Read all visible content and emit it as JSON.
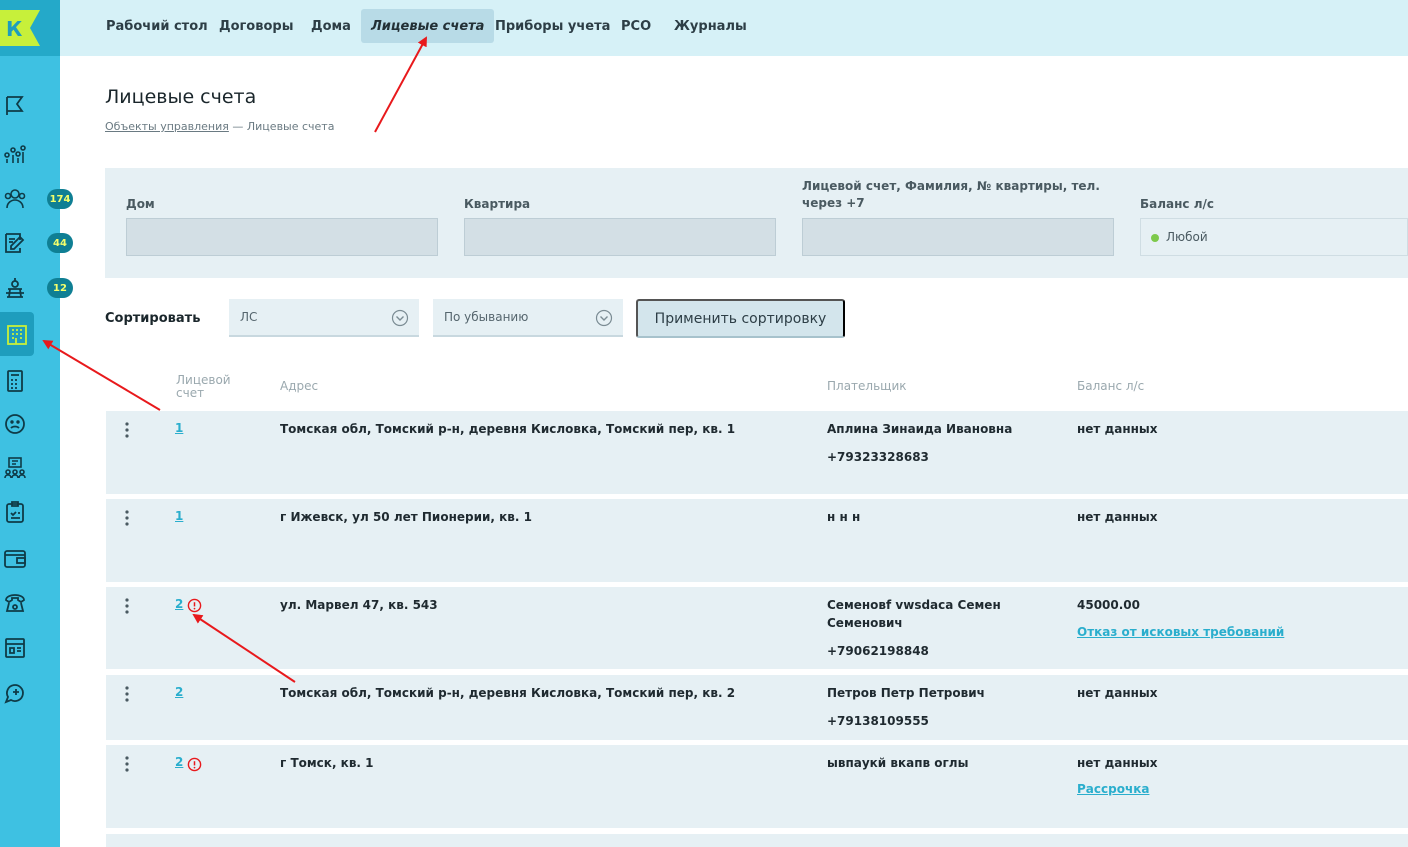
{
  "app": {
    "logo_letter": "К"
  },
  "sidebar": {
    "icons": [
      "flag-icon",
      "analytics-icon",
      "residents-icon",
      "edit-document-icon",
      "inspector-icon",
      "buildings-icon",
      "calculator-icon",
      "sad-face-icon",
      "meeting-icon",
      "checklist-icon",
      "wallet-icon",
      "phone-icon",
      "calendar-card-icon",
      "add-chat-icon"
    ],
    "badges": {
      "residents": "174",
      "edit": "44",
      "inspector": "12"
    }
  },
  "nav": {
    "items": [
      "Рабочий стол",
      "Договоры",
      "Дома",
      "Лицевые счета",
      "Приборы учета",
      "РСО",
      "Журналы"
    ],
    "active": "Лицевые счета"
  },
  "page": {
    "title": "Лицевые счета",
    "breadcrumb_link": "Объекты управления",
    "breadcrumb_current": "— Лицевые счета"
  },
  "filters": {
    "house_label": "Дом",
    "apartment_label": "Квартира",
    "search_label_line1": "Лицевой счет, Фамилия, № квартиры, тел.",
    "search_label_line2": "через +7",
    "balance_label": "Баланс л/с",
    "balance_value": "Любой"
  },
  "sort": {
    "label": "Сортировать",
    "field_value": "ЛС",
    "order_value": "По убыванию",
    "apply_label": "Применить сортировку"
  },
  "table": {
    "headers": {
      "account_line1": "Лицевой",
      "account_line2": "счет",
      "address": "Адрес",
      "payer": "Плательщик",
      "balance": "Баланс л/с"
    },
    "rows": [
      {
        "account": "1",
        "address": "Томская обл, Томский р-н, деревня Кисловка, Томский пер, кв. 1",
        "payer": "Аплина Зинаида Ивановна",
        "phone": "+79323328683",
        "balance": "нет данных",
        "warning": false
      },
      {
        "account": "1",
        "address": "г Ижевск, ул 50 лет Пионерии, кв. 1",
        "payer": "н н н",
        "phone": "",
        "balance": "нет данных",
        "warning": false
      },
      {
        "account": "2",
        "address": "ул. Марвел 47, кв. 543",
        "payer_line1": "Семеновf vwsdaca Семен",
        "payer_line2": "Семенович",
        "phone": "+79062198848",
        "balance": "45000.00",
        "balance_link": "Отказ от исковых требований",
        "warning": true
      },
      {
        "account": "2",
        "address": "Томская обл, Томский р-н, деревня Кисловка, Томский пер, кв. 2",
        "payer": "Петров Петр Петрович",
        "phone": "+79138109555",
        "balance": "нет данных",
        "warning": false
      },
      {
        "account": "2",
        "address": "г Томск, кв. 1",
        "payer": "ывпаукй вкапв оглы",
        "phone": "",
        "balance": "нет данных",
        "balance_link": "Рассрочка",
        "warning": true
      }
    ]
  },
  "colors": {
    "sidebar": "#3ec1e2",
    "topnav": "#d6f1f7",
    "link": "#2aaecd",
    "annotation": "#e8191c"
  }
}
